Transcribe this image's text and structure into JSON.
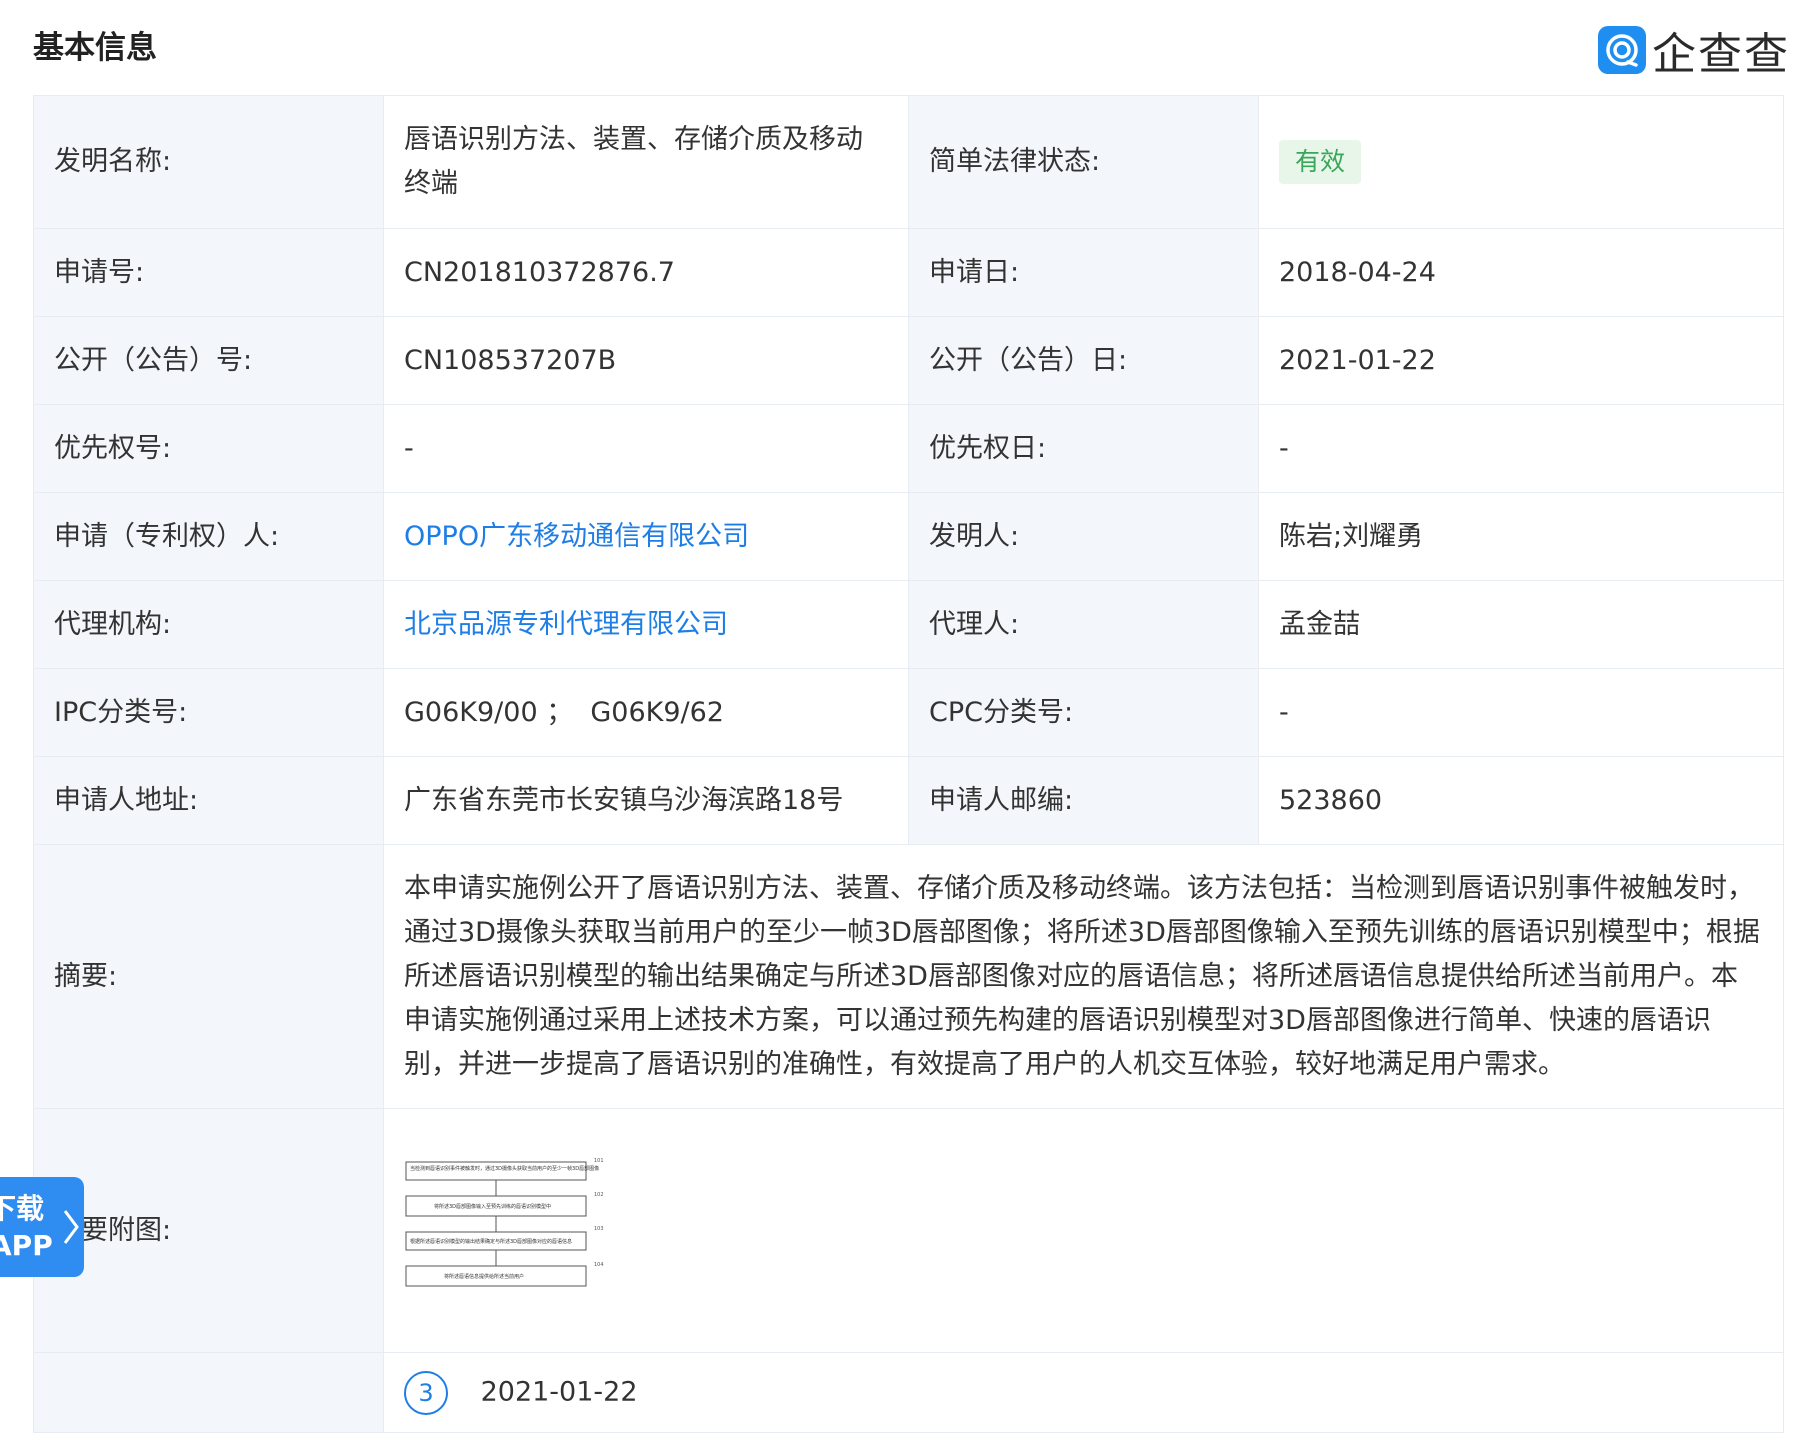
{
  "header": {
    "title": "基本信息",
    "brand": "企查查"
  },
  "fields": {
    "invention_name": {
      "label": "发明名称:",
      "value": "唇语识别方法、装置、存储介质及移动终端"
    },
    "legal_status": {
      "label": "简单法律状态:",
      "value": "有效"
    },
    "application_no": {
      "label": "申请号:",
      "value": "CN201810372876.7"
    },
    "application_date": {
      "label": "申请日:",
      "value": "2018-04-24"
    },
    "publication_no": {
      "label": "公开（公告）号:",
      "value": "CN108537207B"
    },
    "publication_date": {
      "label": "公开（公告）日:",
      "value": "2021-01-22"
    },
    "priority_no": {
      "label": "优先权号:",
      "value": "-"
    },
    "priority_date": {
      "label": "优先权日:",
      "value": "-"
    },
    "applicant": {
      "label": "申请（专利权）人:",
      "value": "OPPO广东移动通信有限公司"
    },
    "inventor": {
      "label": "发明人:",
      "value": "陈岩;刘耀勇"
    },
    "agency": {
      "label": "代理机构:",
      "value": "北京品源专利代理有限公司"
    },
    "agent": {
      "label": "代理人:",
      "value": "孟金喆"
    },
    "ipc": {
      "label": "IPC分类号:",
      "value": "G06K9/00 ；  G06K9/62"
    },
    "cpc": {
      "label": "CPC分类号:",
      "value": "-"
    },
    "address": {
      "label": "申请人地址:",
      "value": "广东省东莞市长安镇乌沙海滨路18号"
    },
    "postcode": {
      "label": "申请人邮编:",
      "value": "523860"
    },
    "abstract": {
      "label": "摘要:",
      "value": "本申请实施例公开了唇语识别方法、装置、存储介质及移动终端。该方法包括：当检测到唇语识别事件被触发时，通过3D摄像头获取当前用户的至少一帧3D唇部图像；将所述3D唇部图像输入至预先训练的唇语识别模型中；根据所述唇语识别模型的输出结果确定与所述3D唇部图像对应的唇语信息；将所述唇语信息提供给所述当前用户。本申请实施例通过采用上述技术方案，可以通过预先构建的唇语识别模型对3D唇部图像进行简单、快速的唇语识别，并进一步提高了唇语识别的准确性，有效提高了用户的人机交互体验，较好地满足用户需求。"
    },
    "figure": {
      "label": "摘要附图:",
      "steps": [
        {
          "num": "101",
          "text": "当检测到唇语识别事件被触发时，通过3D摄像头获取当前用户的至少一帧3D唇部图像"
        },
        {
          "num": "102",
          "text": "将所述3D唇部图像输入至预先训练的唇语识别模型中"
        },
        {
          "num": "103",
          "text": "根据所述唇语识别模型的输出结果确定与所述3D唇部图像对应的唇语信息"
        },
        {
          "num": "104",
          "text": "将所述唇语信息提供给所述当前用户"
        }
      ]
    }
  },
  "timeline": {
    "step": "3",
    "date": "2021-01-22"
  },
  "app_float": {
    "line1": "下载",
    "line2": "APP"
  }
}
